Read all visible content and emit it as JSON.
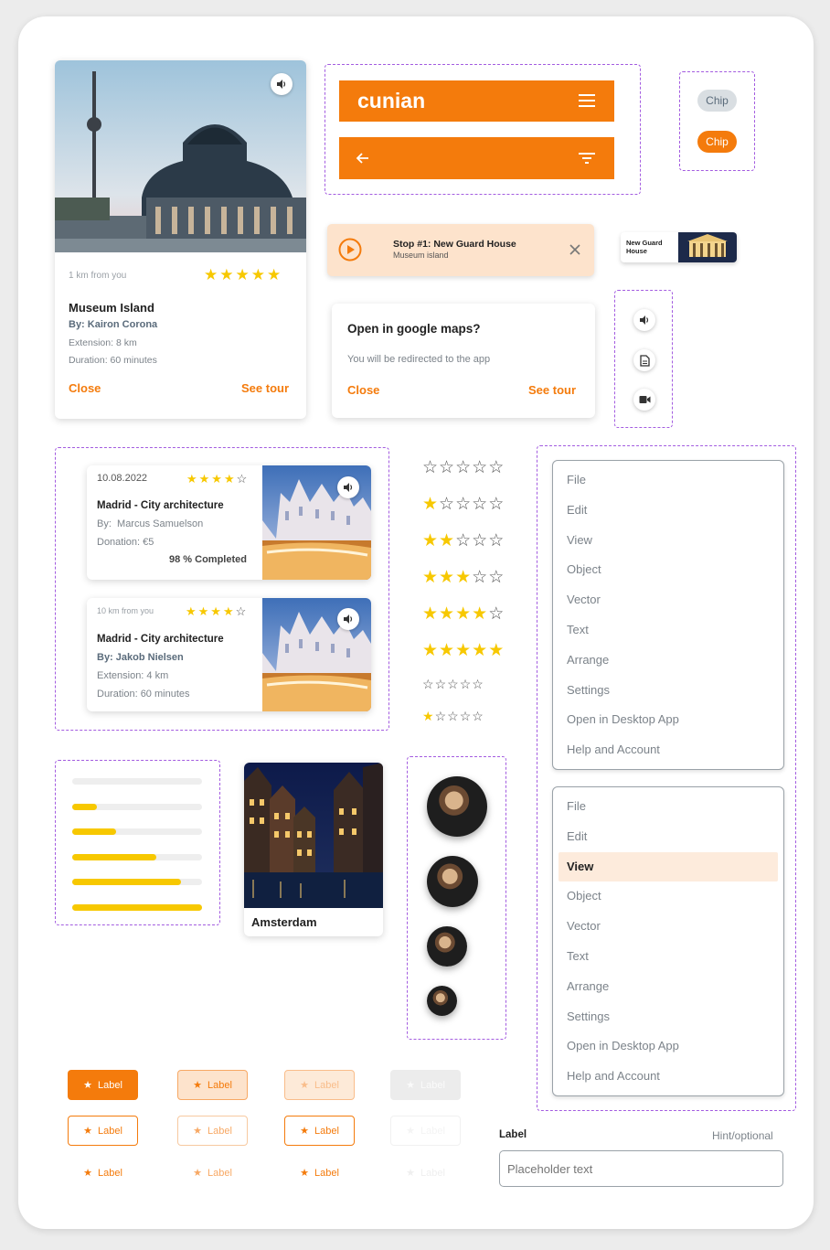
{
  "tour_card": {
    "distance": "1 km from you",
    "rating_stars": "★★★★★",
    "title": "Museum Island",
    "by": "By: Kairon Corona",
    "extension": "Extension: 8 km",
    "duration": "Duration: 60 minutes",
    "close_label": "Close",
    "see_tour_label": "See tour"
  },
  "appbar": {
    "brand": "cunian"
  },
  "chips": [
    {
      "label": "Chip"
    },
    {
      "label": "Chip"
    }
  ],
  "stop_banner": {
    "title": "Stop #1: New Guard House",
    "subtitle": "Museum island"
  },
  "mini_card": {
    "title": "New Guard House"
  },
  "dialog": {
    "title": "Open in google maps?",
    "body": "You will be redirected to the app",
    "close_label": "Close",
    "see_tour_label": "See tour"
  },
  "list_cards": [
    {
      "date": "10.08.2022",
      "title": "Madrid - City architecture",
      "by_prefix": "By:",
      "by_name": "Marcus Samuelson",
      "donation": "Donation:  €5",
      "completed": "98 % Completed"
    },
    {
      "distance": "10 km from you",
      "title": "Madrid - City architecture",
      "by": "By: Jakob Nielsen",
      "extension": "Extension: 4 km",
      "duration": "Duration: 60 minutes"
    }
  ],
  "ratings": [
    {
      "value": 0,
      "max": 5,
      "size": "large"
    },
    {
      "value": 1,
      "max": 5,
      "size": "large"
    },
    {
      "value": 2,
      "max": 5,
      "size": "large"
    },
    {
      "value": 3,
      "max": 5,
      "size": "large"
    },
    {
      "value": 4,
      "max": 5,
      "size": "large"
    },
    {
      "value": 5,
      "max": 5,
      "size": "large"
    },
    {
      "value": 0,
      "max": 5,
      "size": "small"
    },
    {
      "value": 1,
      "max": 5,
      "size": "small"
    }
  ],
  "menu_items": [
    "File",
    "Edit",
    "View",
    "Object",
    "Vector",
    "Text",
    "Arrange",
    "Settings",
    "Open in Desktop App",
    "Help and Account"
  ],
  "menu2_selected_index": 2,
  "progress_values": [
    0,
    0.19,
    0.34,
    0.65,
    0.84,
    1.0
  ],
  "city_card": {
    "title": "Amsterdam"
  },
  "buttons": {
    "label": "Label"
  },
  "text_field": {
    "label": "Label",
    "hint": "Hint/optional",
    "placeholder": "Placeholder text"
  },
  "icons": {
    "sound": "volume-icon",
    "menu": "hamburger-menu-icon",
    "back": "arrow-left-icon",
    "filter": "filter-icon",
    "play": "play-icon",
    "close": "close-icon",
    "document": "document-icon",
    "video": "video-camera-icon",
    "star": "star-icon"
  },
  "colors": {
    "brand_orange": "#f47b0c",
    "star_yellow": "#f7c800",
    "dashed_purple": "#a35ce0",
    "highlight_peach": "#fdebdc"
  }
}
